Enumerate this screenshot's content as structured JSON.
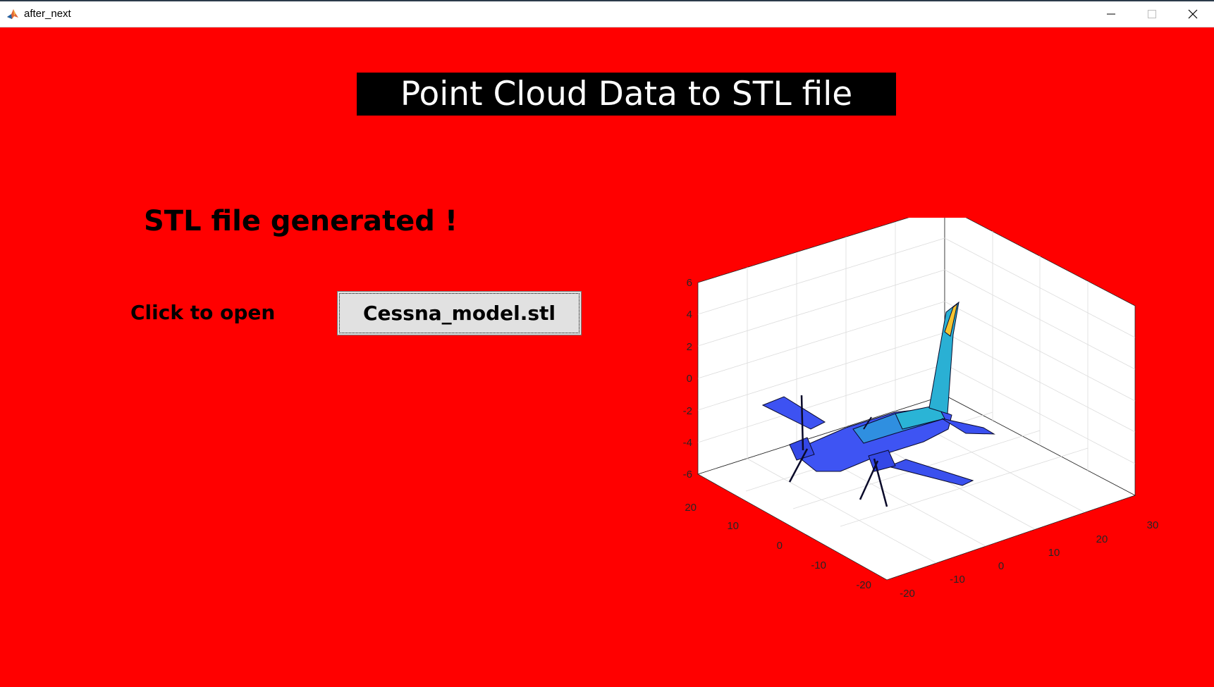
{
  "window": {
    "title": "after_next",
    "controls": [
      "minimize",
      "maximize",
      "close"
    ]
  },
  "banner": {
    "text": "Point Cloud Data to STL file"
  },
  "status": {
    "text": "STL file generated !"
  },
  "open_label": "Click to open",
  "file_button": {
    "label": "Cessna_model.stl"
  },
  "plot": {
    "type": "3d-mesh",
    "object": "aircraft model",
    "z_ticks": [
      "6",
      "4",
      "2",
      "0",
      "-2",
      "-4",
      "-6"
    ],
    "y_ticks": [
      "20",
      "10",
      "0",
      "-10",
      "-20"
    ],
    "x_ticks": [
      "-20",
      "-10",
      "0",
      "10",
      "20",
      "30"
    ],
    "grid": true,
    "colors": {
      "fuselage": "#3a4ff0",
      "mid_body": "#2aa8d8",
      "tail_tip": "#f5c431",
      "background": "#ff0000"
    }
  }
}
